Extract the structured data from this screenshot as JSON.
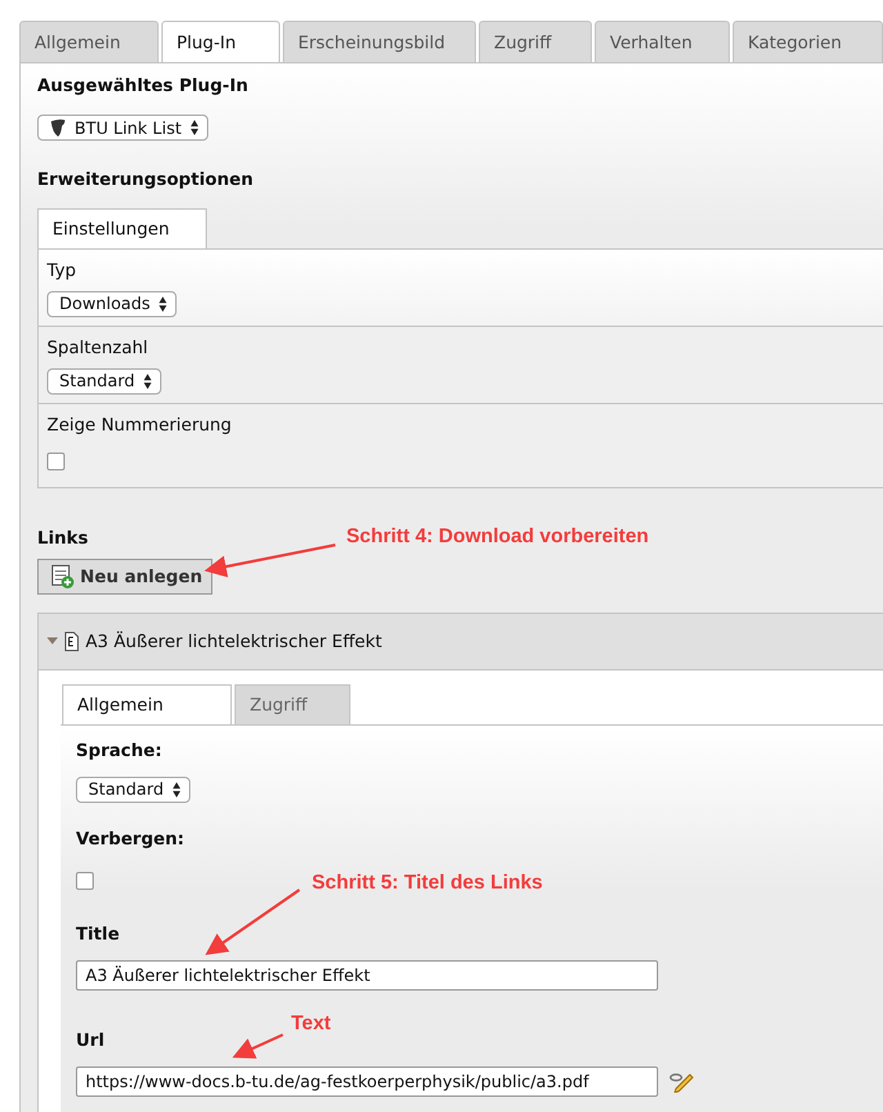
{
  "tabs": [
    {
      "label": "Allgemein",
      "selected": false
    },
    {
      "label": "Plug-In",
      "selected": true
    },
    {
      "label": "Erscheinungsbild",
      "selected": false
    },
    {
      "label": "Zugriff",
      "selected": false
    },
    {
      "label": "Verhalten",
      "selected": false
    },
    {
      "label": "Kategorien",
      "selected": false
    }
  ],
  "plugin": {
    "heading": "Ausgewähltes Plug-In",
    "select": "BTU Link List",
    "options_heading": "Erweiterungsoptionen",
    "subtabs": [
      {
        "label": "Einstellungen",
        "selected": true
      }
    ],
    "fields": [
      {
        "kind": "select",
        "label": "Typ",
        "value": "Downloads"
      },
      {
        "kind": "select",
        "label": "Spaltenzahl",
        "value": "Standard"
      },
      {
        "kind": "checkbox",
        "label": "Zeige Nummerierung",
        "checked": false
      }
    ]
  },
  "links": {
    "heading": "Links",
    "new_button": "Neu anlegen",
    "record": {
      "title": "A3 Äußerer lichtelektrischer Effekt",
      "expanded": true,
      "tabs": [
        {
          "label": "Allgemein",
          "selected": true
        },
        {
          "label": "Zugriff",
          "selected": false
        }
      ],
      "fields": [
        {
          "kind": "select",
          "label": "Sprache:",
          "value": "Standard"
        },
        {
          "kind": "checkbox",
          "label": "Verbergen:",
          "checked": false
        },
        {
          "kind": "text",
          "label": "Title",
          "value": "A3 Äußerer lichtelektrischer Effekt"
        },
        {
          "kind": "link",
          "label": "Url",
          "value": "https://www-docs.b-tu.de/ag-festkoerperphysik/public/a3.pdf"
        }
      ]
    }
  },
  "annotations": [
    "Schritt 4: Download vorbereiten",
    "Schritt 5: Titel des Links",
    "Text"
  ]
}
